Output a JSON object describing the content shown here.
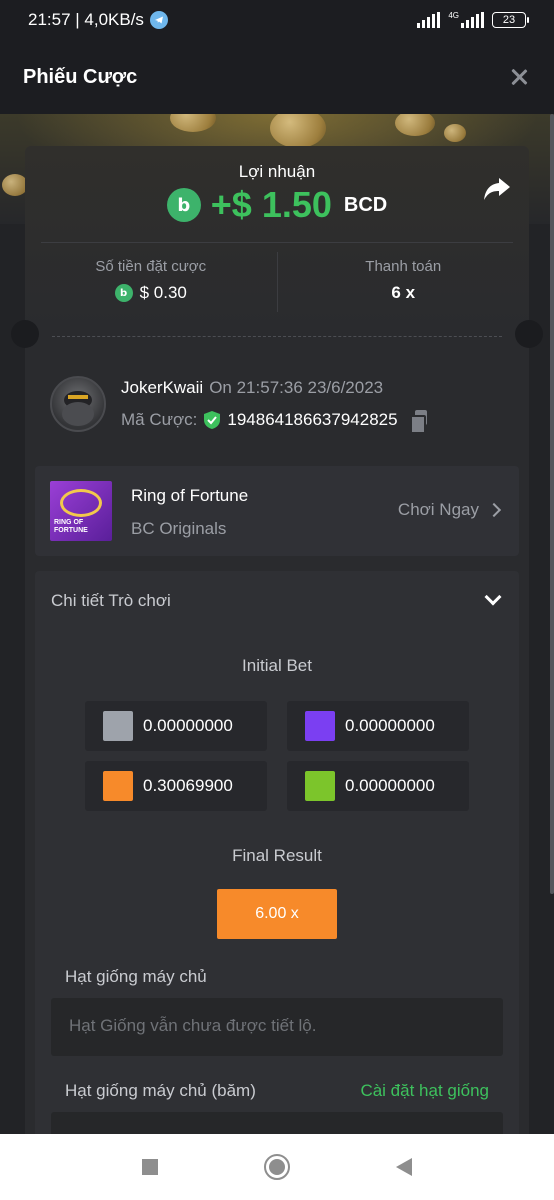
{
  "status_bar": {
    "time_speed": "21:57 | 4,0KB/s",
    "network": "4G",
    "battery": "23"
  },
  "header": {
    "title": "Phiếu Cược"
  },
  "summary": {
    "profit_label": "Lợi nhuận",
    "profit_amount": "+$ 1.50",
    "currency": "BCD",
    "bet_amount_label": "Số tiền đặt cược",
    "bet_amount": "$ 0.30",
    "payout_label": "Thanh toán",
    "payout": "6 x",
    "accent_color": "#3dc15d"
  },
  "user": {
    "name": "JokerKwaii",
    "timestamp": "On 21:57:36 23/6/2023",
    "bet_id_label": "Mã Cược:",
    "bet_id": "194864186637942825"
  },
  "game": {
    "name": "Ring of Fortune",
    "provider": "BC Originals",
    "play_label": "Chơi Ngay",
    "thumb_text_1": "RING OF",
    "thumb_text_2": "FORTUNE"
  },
  "details": {
    "title": "Chi tiết Trò chơi",
    "initial_bet_label": "Initial Bet",
    "bets": [
      {
        "color": "#9ea3ab",
        "value": "0.00000000"
      },
      {
        "color": "#7b3ff2",
        "value": "0.00000000"
      },
      {
        "color": "#f78a2a",
        "value": "0.30069900"
      },
      {
        "color": "#7cc52b",
        "value": "0.00000000"
      }
    ],
    "final_result_label": "Final Result",
    "final_result": "6.00 x",
    "server_seed_label": "Hạt giống máy chủ",
    "server_seed_value": "Hạt Giống vẫn chưa được tiết lộ.",
    "server_seed_hash_label": "Hạt giống máy chủ (băm)",
    "set_seed_label": "Cài đặt hạt giống"
  }
}
